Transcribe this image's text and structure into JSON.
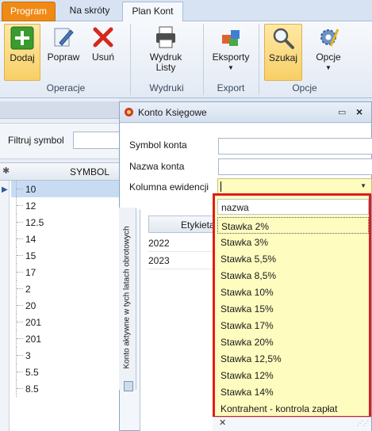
{
  "tabs": {
    "program": "Program",
    "na_skroty": "Na skróty",
    "plan_kont": "Plan Kont"
  },
  "ribbon": {
    "dodaj": "Dodaj",
    "popraw": "Popraw",
    "usun": "Usuń",
    "wydruk_line1": "Wydruk",
    "wydruk_line2": "Listy",
    "eksporty": "Eksporty",
    "szukaj": "Szukaj",
    "opcje": "Opcje",
    "groups": {
      "operacje": "Operacje",
      "wydruki": "Wydruki",
      "export": "Export",
      "opcje": "Opcje"
    }
  },
  "filter": {
    "label": "Filtruj symbol",
    "value": ""
  },
  "grid": {
    "column": "SYMBOL",
    "rows": [
      "10",
      "12",
      "12.5",
      "14",
      "15",
      "17",
      "2",
      "20",
      "201",
      "201",
      "3",
      "5.5",
      "8.5"
    ],
    "selected_index": 0
  },
  "dialog": {
    "title": "Konto Księgowe",
    "symbol_label": "Symbol konta",
    "nazwa_label": "Nazwa konta",
    "kolumna_label": "Kolumna ewidencji",
    "symbol_value": "",
    "nazwa_value": "",
    "side_tab": "Konto aktywne w tych latach obrotowych",
    "inner_grid": {
      "column": "Etykieta",
      "rows": [
        "2022",
        "2023"
      ]
    }
  },
  "dropdown": {
    "header": "nazwa",
    "items": [
      "Stawka 2%",
      "Stawka 3%",
      "Stawka 5,5%",
      "Stawka 8,5%",
      "Stawka 10%",
      "Stawka 15%",
      "Stawka 17%",
      "Stawka 20%",
      "Stawka 12,5%",
      "Stawka 12%",
      "Stawka 14%",
      "Kontrahent - kontrola zapłat"
    ]
  },
  "colors": {
    "accent_orange": "#f08a16",
    "highlight_red": "#e01b1b",
    "combo_yellow": "#fffcc0"
  }
}
